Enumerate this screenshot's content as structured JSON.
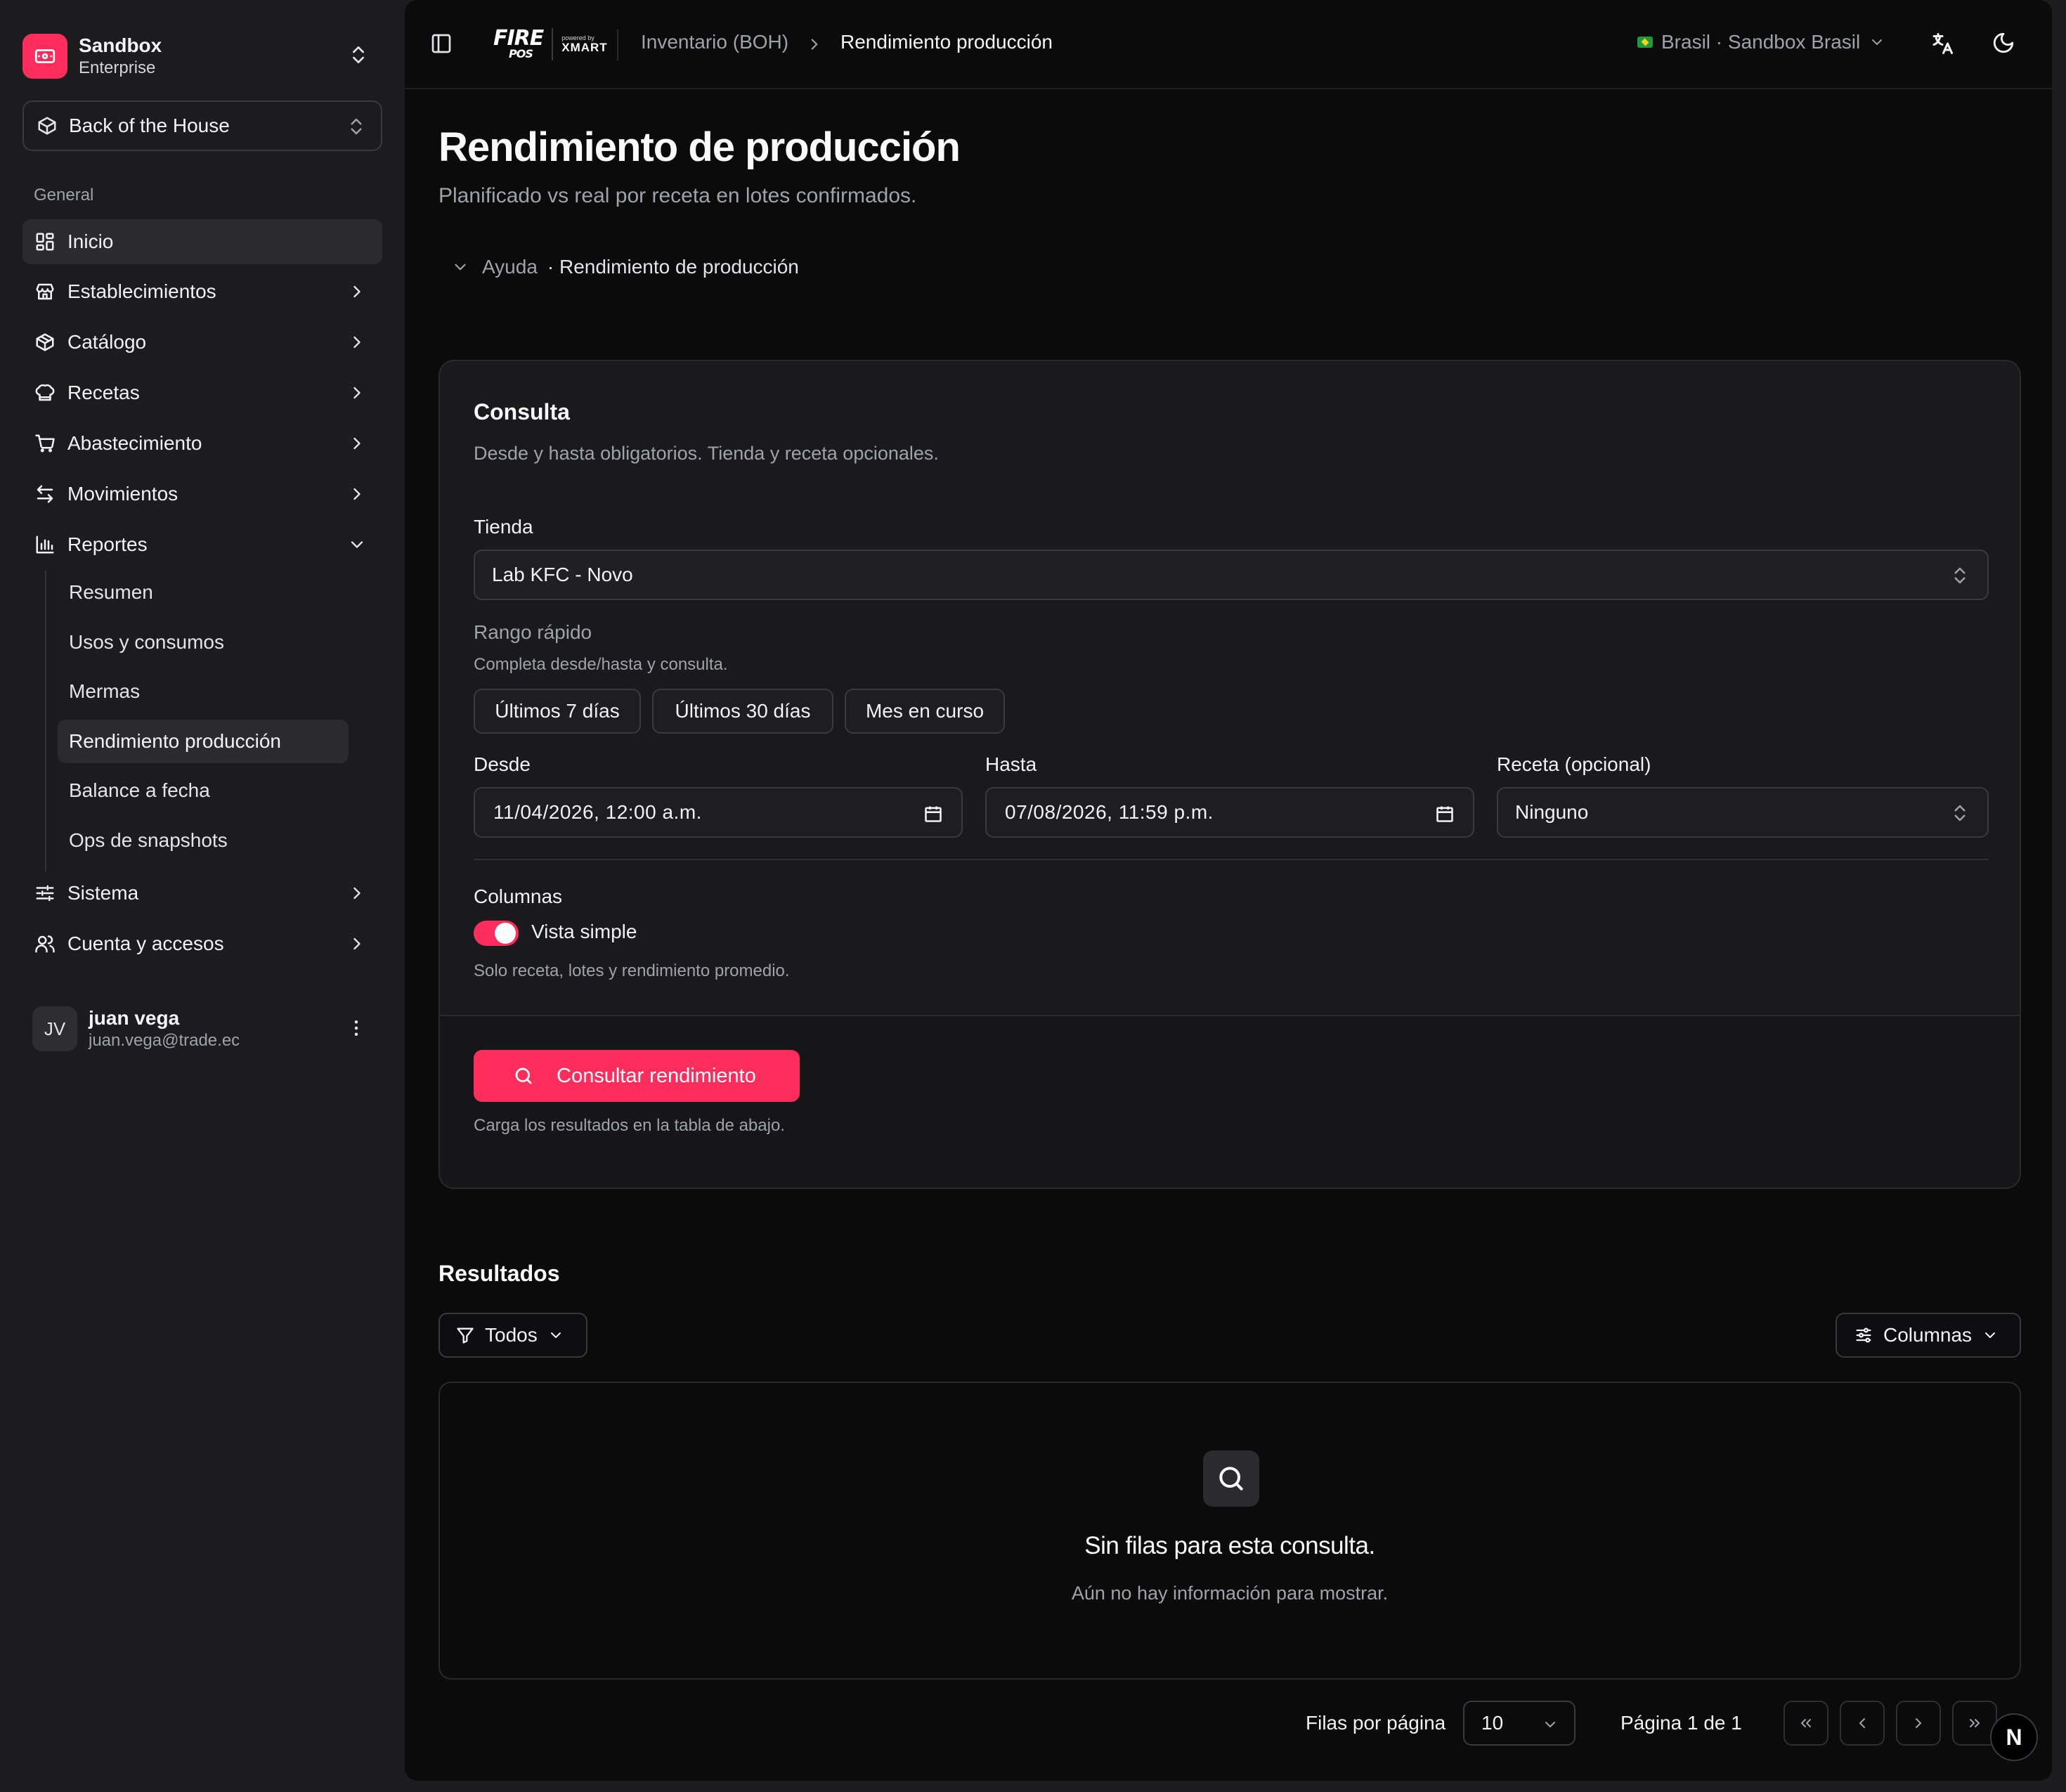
{
  "colors": {
    "accent": "#fe2d5c",
    "background": "#0b0b0c",
    "sidebar": "#1c1c1e"
  },
  "org": {
    "name": "Sandbox",
    "plan": "Enterprise",
    "icon": "ticket-icon"
  },
  "module": {
    "label": "Back of the House",
    "icon": "box-icon"
  },
  "nav": {
    "group_label": "General",
    "items": [
      {
        "label": "Inicio",
        "icon": "layout-grid-icon"
      },
      {
        "label": "Establecimientos",
        "icon": "store-icon"
      },
      {
        "label": "Catálogo",
        "icon": "package-icon"
      },
      {
        "label": "Recetas",
        "icon": "chef-hat-icon"
      },
      {
        "label": "Abastecimiento",
        "icon": "cart-icon"
      },
      {
        "label": "Movimientos",
        "icon": "arrows-swap-icon"
      },
      {
        "label": "Reportes",
        "icon": "bar-chart-icon"
      },
      {
        "label": "Sistema",
        "icon": "sliders-icon"
      },
      {
        "label": "Cuenta y accesos",
        "icon": "users-icon"
      }
    ],
    "reportes_sub": [
      {
        "label": "Resumen"
      },
      {
        "label": "Usos y consumos"
      },
      {
        "label": "Mermas"
      },
      {
        "label": "Rendimiento producción"
      },
      {
        "label": "Balance a fecha"
      },
      {
        "label": "Ops de snapshots"
      }
    ]
  },
  "user": {
    "initials": "JV",
    "name": "juan vega",
    "email": "juan.vega@trade.ec"
  },
  "brand": {
    "logo": "FIRE",
    "logo_sub": "POS",
    "powered": "powered by",
    "partner": "XMART"
  },
  "breadcrumb": {
    "parent": "Inventario (BOH)",
    "current": "Rendimiento producción"
  },
  "region": {
    "label": "Brasil · Sandbox Brasil",
    "flag": "brazil-flag-icon"
  },
  "page": {
    "title": "Rendimiento de producción",
    "subtitle": "Planificado vs real por receta en lotes confirmados.",
    "help_label": "Ayuda",
    "help_topic": "· Rendimiento de producción"
  },
  "query": {
    "title": "Consulta",
    "description": "Desde y hasta obligatorios. Tienda y receta opcionales.",
    "store_label": "Tienda",
    "store_value": "Lab KFC - Novo",
    "range_label": "Rango rápido",
    "range_hint": "Completa desde/hasta y consulta.",
    "range_chips": [
      "Últimos 7 días",
      "Últimos 30 días",
      "Mes en curso"
    ],
    "from_label": "Desde",
    "from_value": "11/04/2026, 12:00 a.m.",
    "to_label": "Hasta",
    "to_value": "07/08/2026, 11:59 p.m.",
    "recipe_label": "Receta (opcional)",
    "recipe_value": "Ninguno",
    "columns_label": "Columnas",
    "simple_view_label": "Vista simple",
    "simple_view_on": true,
    "simple_view_hint": "Solo receta, lotes y rendimiento promedio.",
    "submit_label": "Consultar rendimiento",
    "submit_hint": "Carga los resultados en la tabla de abajo."
  },
  "results": {
    "title": "Resultados",
    "filter_label": "Todos",
    "columns_label": "Columnas",
    "empty_title": "Sin filas para esta consulta.",
    "empty_subtitle": "Aún no hay información para mostrar.",
    "rows_per_page_label": "Filas por página",
    "rows_per_page": "10",
    "page_info": "Página 1 de 1"
  },
  "badge": {
    "label": "N"
  }
}
